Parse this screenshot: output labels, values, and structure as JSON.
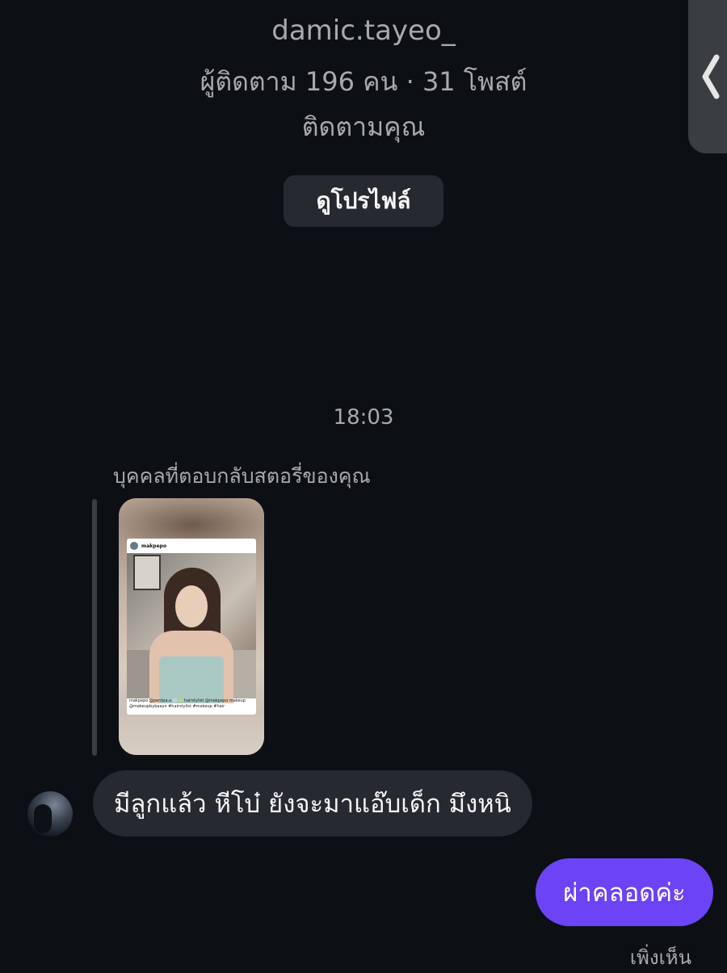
{
  "profile": {
    "username": "damic.tayeo_",
    "stats": "ผู้ติดตาม 196 คน · 31 โพสต์",
    "follows_you": "ติดตามคุณ",
    "view_profile_label": "ดูโปรไฟล์"
  },
  "conversation": {
    "timestamp": "18:03",
    "story_reply_label": "บุคคลที่ตอบกลับสตอรี่ของคุณ",
    "story_post": {
      "username": "makpepo",
      "caption": "makpepo @pentpa.a 💿✨ hairstylist @makpepo makeup @makeupbybaayo #hairstylist #makeup #hair"
    },
    "incoming_message": "มีลูกแล้ว หีโบ๋ ยังจะมาแอ๊บเด็ก มึงหนิ",
    "outgoing_message": "ผ่าคลอดค่ะ",
    "seen_status": "เพิ่งเห็น"
  },
  "colors": {
    "background": "#0c1014",
    "bubble_incoming": "#262a30",
    "bubble_outgoing": "#6c43f5",
    "secondary_text": "#a8a8ad"
  },
  "icons": {
    "edge_handle": "chevron-left-icon"
  }
}
